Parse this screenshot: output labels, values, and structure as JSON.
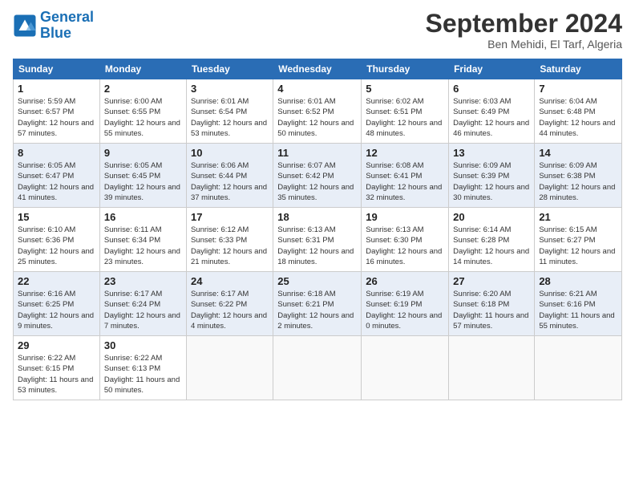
{
  "header": {
    "logo_line1": "General",
    "logo_line2": "Blue",
    "month_title": "September 2024",
    "location": "Ben Mehidi, El Tarf, Algeria"
  },
  "weekdays": [
    "Sunday",
    "Monday",
    "Tuesday",
    "Wednesday",
    "Thursday",
    "Friday",
    "Saturday"
  ],
  "weeks": [
    [
      {
        "day": "1",
        "sunrise": "Sunrise: 5:59 AM",
        "sunset": "Sunset: 6:57 PM",
        "daylight": "Daylight: 12 hours and 57 minutes."
      },
      {
        "day": "2",
        "sunrise": "Sunrise: 6:00 AM",
        "sunset": "Sunset: 6:55 PM",
        "daylight": "Daylight: 12 hours and 55 minutes."
      },
      {
        "day": "3",
        "sunrise": "Sunrise: 6:01 AM",
        "sunset": "Sunset: 6:54 PM",
        "daylight": "Daylight: 12 hours and 53 minutes."
      },
      {
        "day": "4",
        "sunrise": "Sunrise: 6:01 AM",
        "sunset": "Sunset: 6:52 PM",
        "daylight": "Daylight: 12 hours and 50 minutes."
      },
      {
        "day": "5",
        "sunrise": "Sunrise: 6:02 AM",
        "sunset": "Sunset: 6:51 PM",
        "daylight": "Daylight: 12 hours and 48 minutes."
      },
      {
        "day": "6",
        "sunrise": "Sunrise: 6:03 AM",
        "sunset": "Sunset: 6:49 PM",
        "daylight": "Daylight: 12 hours and 46 minutes."
      },
      {
        "day": "7",
        "sunrise": "Sunrise: 6:04 AM",
        "sunset": "Sunset: 6:48 PM",
        "daylight": "Daylight: 12 hours and 44 minutes."
      }
    ],
    [
      {
        "day": "8",
        "sunrise": "Sunrise: 6:05 AM",
        "sunset": "Sunset: 6:47 PM",
        "daylight": "Daylight: 12 hours and 41 minutes."
      },
      {
        "day": "9",
        "sunrise": "Sunrise: 6:05 AM",
        "sunset": "Sunset: 6:45 PM",
        "daylight": "Daylight: 12 hours and 39 minutes."
      },
      {
        "day": "10",
        "sunrise": "Sunrise: 6:06 AM",
        "sunset": "Sunset: 6:44 PM",
        "daylight": "Daylight: 12 hours and 37 minutes."
      },
      {
        "day": "11",
        "sunrise": "Sunrise: 6:07 AM",
        "sunset": "Sunset: 6:42 PM",
        "daylight": "Daylight: 12 hours and 35 minutes."
      },
      {
        "day": "12",
        "sunrise": "Sunrise: 6:08 AM",
        "sunset": "Sunset: 6:41 PM",
        "daylight": "Daylight: 12 hours and 32 minutes."
      },
      {
        "day": "13",
        "sunrise": "Sunrise: 6:09 AM",
        "sunset": "Sunset: 6:39 PM",
        "daylight": "Daylight: 12 hours and 30 minutes."
      },
      {
        "day": "14",
        "sunrise": "Sunrise: 6:09 AM",
        "sunset": "Sunset: 6:38 PM",
        "daylight": "Daylight: 12 hours and 28 minutes."
      }
    ],
    [
      {
        "day": "15",
        "sunrise": "Sunrise: 6:10 AM",
        "sunset": "Sunset: 6:36 PM",
        "daylight": "Daylight: 12 hours and 25 minutes."
      },
      {
        "day": "16",
        "sunrise": "Sunrise: 6:11 AM",
        "sunset": "Sunset: 6:34 PM",
        "daylight": "Daylight: 12 hours and 23 minutes."
      },
      {
        "day": "17",
        "sunrise": "Sunrise: 6:12 AM",
        "sunset": "Sunset: 6:33 PM",
        "daylight": "Daylight: 12 hours and 21 minutes."
      },
      {
        "day": "18",
        "sunrise": "Sunrise: 6:13 AM",
        "sunset": "Sunset: 6:31 PM",
        "daylight": "Daylight: 12 hours and 18 minutes."
      },
      {
        "day": "19",
        "sunrise": "Sunrise: 6:13 AM",
        "sunset": "Sunset: 6:30 PM",
        "daylight": "Daylight: 12 hours and 16 minutes."
      },
      {
        "day": "20",
        "sunrise": "Sunrise: 6:14 AM",
        "sunset": "Sunset: 6:28 PM",
        "daylight": "Daylight: 12 hours and 14 minutes."
      },
      {
        "day": "21",
        "sunrise": "Sunrise: 6:15 AM",
        "sunset": "Sunset: 6:27 PM",
        "daylight": "Daylight: 12 hours and 11 minutes."
      }
    ],
    [
      {
        "day": "22",
        "sunrise": "Sunrise: 6:16 AM",
        "sunset": "Sunset: 6:25 PM",
        "daylight": "Daylight: 12 hours and 9 minutes."
      },
      {
        "day": "23",
        "sunrise": "Sunrise: 6:17 AM",
        "sunset": "Sunset: 6:24 PM",
        "daylight": "Daylight: 12 hours and 7 minutes."
      },
      {
        "day": "24",
        "sunrise": "Sunrise: 6:17 AM",
        "sunset": "Sunset: 6:22 PM",
        "daylight": "Daylight: 12 hours and 4 minutes."
      },
      {
        "day": "25",
        "sunrise": "Sunrise: 6:18 AM",
        "sunset": "Sunset: 6:21 PM",
        "daylight": "Daylight: 12 hours and 2 minutes."
      },
      {
        "day": "26",
        "sunrise": "Sunrise: 6:19 AM",
        "sunset": "Sunset: 6:19 PM",
        "daylight": "Daylight: 12 hours and 0 minutes."
      },
      {
        "day": "27",
        "sunrise": "Sunrise: 6:20 AM",
        "sunset": "Sunset: 6:18 PM",
        "daylight": "Daylight: 11 hours and 57 minutes."
      },
      {
        "day": "28",
        "sunrise": "Sunrise: 6:21 AM",
        "sunset": "Sunset: 6:16 PM",
        "daylight": "Daylight: 11 hours and 55 minutes."
      }
    ],
    [
      {
        "day": "29",
        "sunrise": "Sunrise: 6:22 AM",
        "sunset": "Sunset: 6:15 PM",
        "daylight": "Daylight: 11 hours and 53 minutes."
      },
      {
        "day": "30",
        "sunrise": "Sunrise: 6:22 AM",
        "sunset": "Sunset: 6:13 PM",
        "daylight": "Daylight: 11 hours and 50 minutes."
      },
      null,
      null,
      null,
      null,
      null
    ]
  ]
}
